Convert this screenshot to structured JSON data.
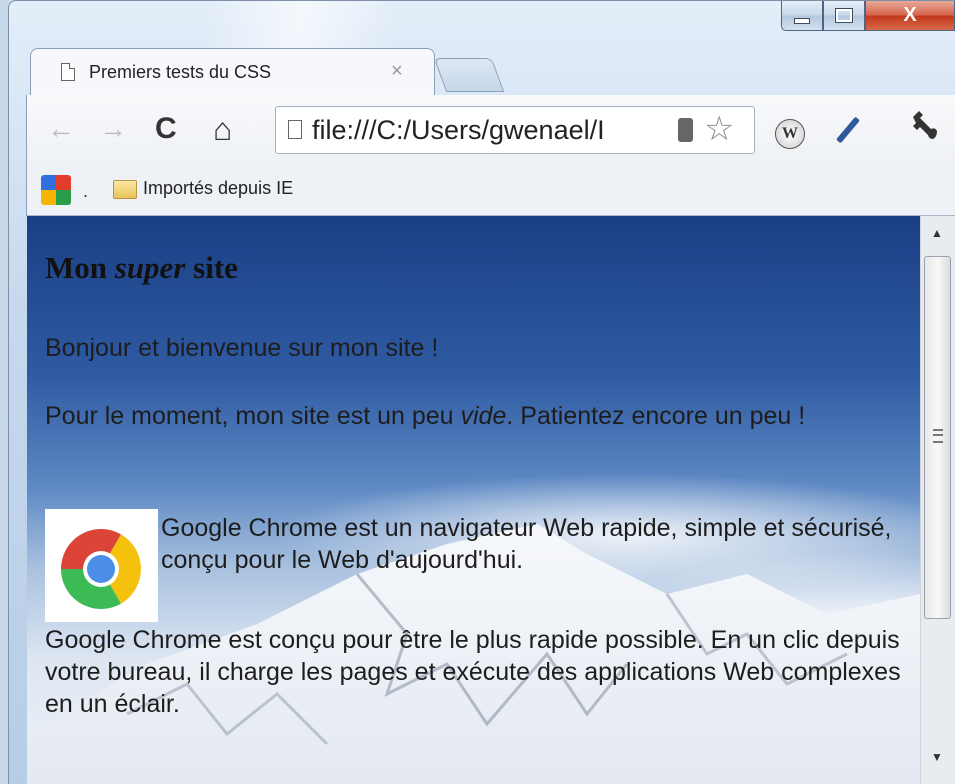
{
  "window": {
    "caption_buttons": [
      "minimize",
      "maximize",
      "close"
    ],
    "close_glyph": "X"
  },
  "tab": {
    "title": "Premiers tests du CSS",
    "close_glyph": "×"
  },
  "toolbar": {
    "back_glyph": "←",
    "forward_glyph": "→",
    "reload_glyph": "C",
    "home_glyph": "⌂",
    "url": "file:///C:/Users/gwenael/Documents/",
    "url_visible": "file:///C:/Users/gwenael/I",
    "star_glyph": "☆",
    "wiki_glyph": "W",
    "wrench_glyph": "🔧"
  },
  "bookmarks": {
    "dot": ".",
    "folder_label": "Importés depuis IE"
  },
  "page": {
    "heading_pre": "Mon ",
    "heading_em": "super",
    "heading_post": " site",
    "p1": "Bonjour et bienvenue sur mon site !",
    "p2_pre": "Pour le moment, mon site est un peu ",
    "p2_em": "vide",
    "p2_post": ". Patientez encore un peu !",
    "chrome_text": "Google Chrome est un navigateur Web rapide, simple et sécurisé, conçu pour le Web d'aujourd'hui.",
    "p3": "Google Chrome est conçu pour être le plus rapide possible. En un clic depuis votre bureau, il charge les pages et exécute des applications Web complexes en un éclair."
  },
  "colors": {
    "sky_top": "#1a3f84",
    "close_red": "#c2371b",
    "frame": "#c6d8ee"
  },
  "icons": [
    "page-icon",
    "back-arrow-icon",
    "forward-arrow-icon",
    "reload-icon",
    "home-icon",
    "device-icon",
    "star-icon",
    "wikipedia-icon",
    "pen-icon",
    "wrench-icon",
    "google-bookmarks-icon",
    "folder-icon",
    "chrome-logo-icon"
  ]
}
